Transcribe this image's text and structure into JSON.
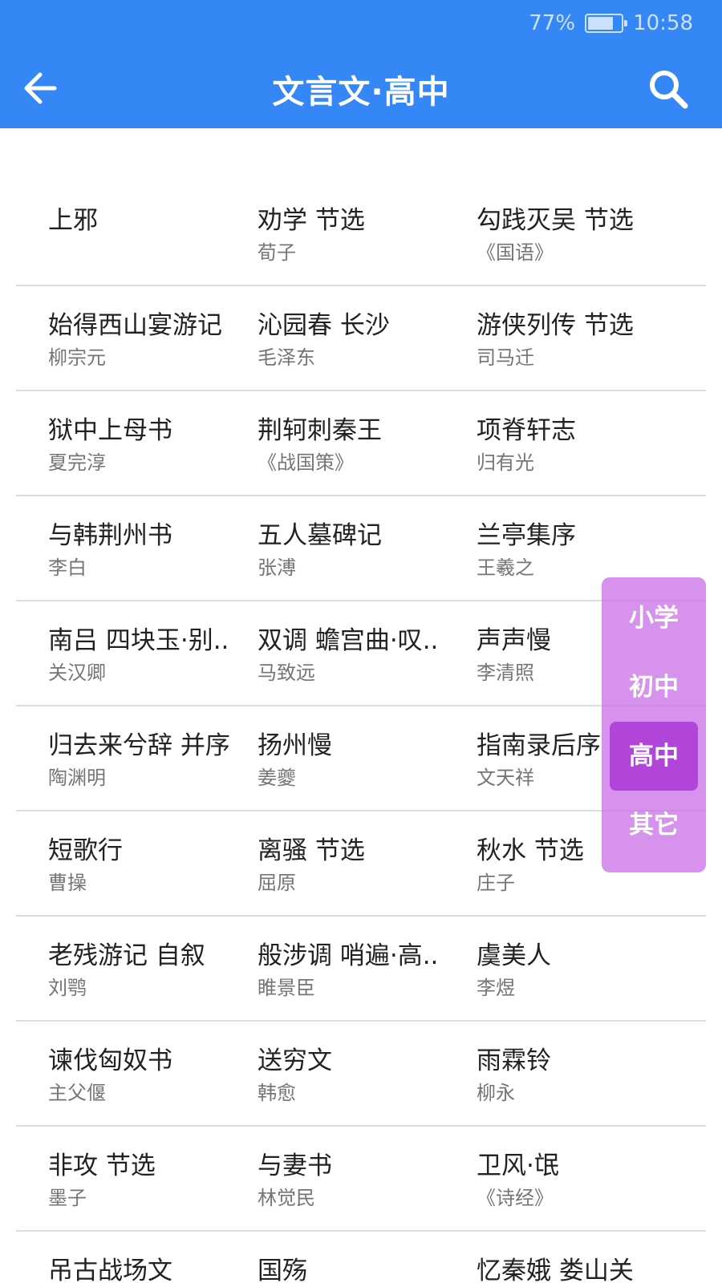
{
  "status": {
    "battery_text": "77%",
    "battery_level": 0.77,
    "time": "10:58"
  },
  "appbar": {
    "title": "文言文·高中",
    "back_icon": "arrow-left-icon",
    "search_icon": "search-icon"
  },
  "rows": [
    [
      {
        "title": "上邪",
        "author": ""
      },
      {
        "title": "劝学 节选",
        "author": "荀子"
      },
      {
        "title": "勾践灭吴 节选",
        "author": "《国语》"
      }
    ],
    [
      {
        "title": "始得西山宴游记",
        "author": "柳宗元"
      },
      {
        "title": "沁园春 长沙",
        "author": "毛泽东"
      },
      {
        "title": "游侠列传 节选",
        "author": "司马迁"
      }
    ],
    [
      {
        "title": "狱中上母书",
        "author": "夏完淳"
      },
      {
        "title": "荆轲刺秦王",
        "author": "《战国策》"
      },
      {
        "title": "项脊轩志",
        "author": "归有光"
      }
    ],
    [
      {
        "title": "与韩荆州书",
        "author": "李白"
      },
      {
        "title": "五人墓碑记",
        "author": "张溥"
      },
      {
        "title": "兰亭集序",
        "author": "王羲之"
      }
    ],
    [
      {
        "title": "南吕 四块玉·别..",
        "author": "关汉卿"
      },
      {
        "title": "双调 蟾宫曲·叹..",
        "author": "马致远"
      },
      {
        "title": "声声慢",
        "author": "李清照"
      }
    ],
    [
      {
        "title": "归去来兮辞 并序",
        "author": "陶渊明"
      },
      {
        "title": "扬州慢",
        "author": "姜夔"
      },
      {
        "title": "指南录后序",
        "author": "文天祥"
      }
    ],
    [
      {
        "title": "短歌行",
        "author": "曹操"
      },
      {
        "title": "离骚 节选",
        "author": "屈原"
      },
      {
        "title": "秋水 节选",
        "author": "庄子"
      }
    ],
    [
      {
        "title": "老残游记 自叙",
        "author": "刘鹗"
      },
      {
        "title": "般涉调 哨遍·高..",
        "author": "睢景臣"
      },
      {
        "title": "虞美人",
        "author": "李煜"
      }
    ],
    [
      {
        "title": "谏伐匈奴书",
        "author": "主父偃"
      },
      {
        "title": "送穷文",
        "author": "韩愈"
      },
      {
        "title": "雨霖铃",
        "author": "柳永"
      }
    ],
    [
      {
        "title": "非攻 节选",
        "author": "墨子"
      },
      {
        "title": "与妻书",
        "author": "林觉民"
      },
      {
        "title": "卫风·氓",
        "author": "《诗经》"
      }
    ],
    [
      {
        "title": "吊古战场文",
        "author": ""
      },
      {
        "title": "国殇",
        "author": ""
      },
      {
        "title": "忆秦娥 娄山关",
        "author": ""
      }
    ]
  ],
  "levels": {
    "items": [
      "小学",
      "初中",
      "高中",
      "其它"
    ],
    "active": "高中"
  },
  "colors": {
    "appbar": "#3587f5",
    "level_panel": "#d48ae8",
    "level_active": "#b144d9"
  }
}
